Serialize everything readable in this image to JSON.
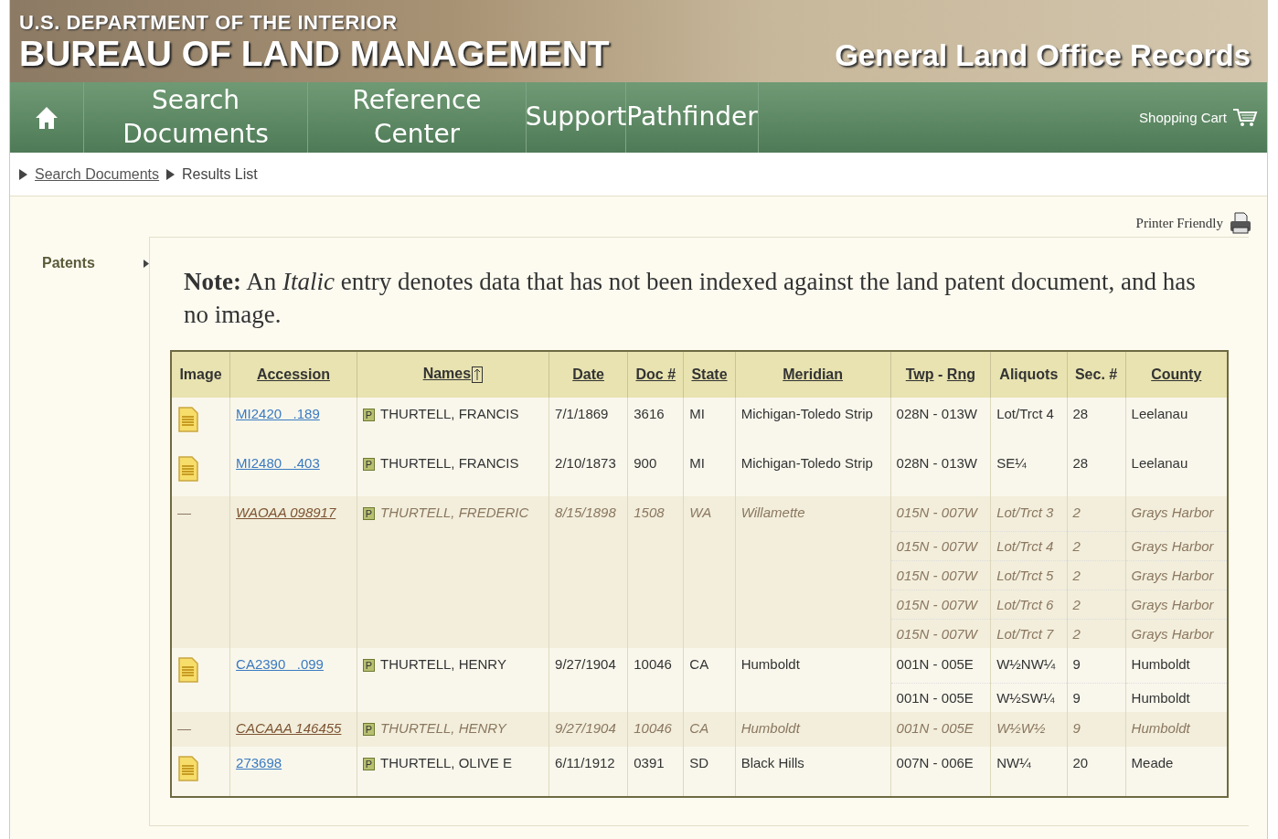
{
  "header": {
    "department": "U.S. DEPARTMENT OF THE INTERIOR",
    "bureau": "BUREAU OF LAND MANAGEMENT",
    "site_title": "General Land Office Records"
  },
  "nav": {
    "items": [
      {
        "label": "Search Documents"
      },
      {
        "label": "Reference Center"
      },
      {
        "label": "Support"
      },
      {
        "label": "Pathfinder"
      }
    ],
    "cart": "Shopping Cart"
  },
  "breadcrumbs": [
    {
      "label": "Search Documents",
      "link": true
    },
    {
      "label": "Results List",
      "link": false
    }
  ],
  "printer_friendly": "Printer Friendly",
  "sidebar": {
    "items": [
      {
        "label": "Patents"
      }
    ]
  },
  "note": "**Note:** An *Italic* entry denotes data that has not been indexed against the land patent document, and has no image.",
  "table": {
    "columns": [
      {
        "label": "Image",
        "sortable": false
      },
      {
        "label": "Accession",
        "sortable": true
      },
      {
        "label": "Names",
        "sortable": true
      },
      {
        "label": "Date",
        "sortable": true
      },
      {
        "label": "Doc #",
        "sortable": true
      },
      {
        "label": "State",
        "sortable": true
      },
      {
        "label": "Meridian",
        "sortable": true
      },
      {
        "label": "Twp",
        "sortable": true,
        "joiner": "-",
        "label_2": "Rng"
      },
      {
        "label": "Aliquots",
        "sortable": false
      },
      {
        "label": "Sec. #",
        "sortable": false
      },
      {
        "label": "County",
        "sortable": true
      }
    ],
    "rows": [
      {
        "kind": "scanned",
        "accession": "MI2420   .189",
        "badge": "P",
        "name": "THURTELL, FRANCIS",
        "date": "7/1/1869",
        "doc": "3616",
        "state": "MI",
        "meridian": "Michigan-Toledo Strip",
        "parcels": [
          {
            "twp_rng": "028N - 013W",
            "aliquots": "Lot/Trct 4",
            "sec": "28",
            "county": "Leelanau"
          }
        ]
      },
      {
        "kind": "scanned",
        "accession": "MI2480   .403",
        "badge": "P",
        "name": "THURTELL, FRANCIS",
        "date": "2/10/1873",
        "doc": "900",
        "state": "MI",
        "meridian": "Michigan-Toledo Strip",
        "parcels": [
          {
            "twp_rng": "028N - 013W",
            "aliquots": "SE¼",
            "sec": "28",
            "county": "Leelanau"
          }
        ]
      },
      {
        "kind": "unindexed",
        "image_text": "—",
        "accession": "WAOAA 098917",
        "badge": "P",
        "name": "THURTELL, FREDERIC",
        "date": "8/15/1898",
        "doc": "1508",
        "state": "WA",
        "meridian": "Willamette",
        "parcels": [
          {
            "twp_rng": "015N - 007W",
            "aliquots": "Lot/Trct 3",
            "sec": "2",
            "county": "Grays Harbor"
          },
          {
            "twp_rng": "015N - 007W",
            "aliquots": "Lot/Trct 4",
            "sec": "2",
            "county": "Grays Harbor"
          },
          {
            "twp_rng": "015N - 007W",
            "aliquots": "Lot/Trct 5",
            "sec": "2",
            "county": "Grays Harbor"
          },
          {
            "twp_rng": "015N - 007W",
            "aliquots": "Lot/Trct 6",
            "sec": "2",
            "county": "Grays Harbor"
          },
          {
            "twp_rng": "015N - 007W",
            "aliquots": "Lot/Trct 7",
            "sec": "2",
            "county": "Grays Harbor"
          }
        ]
      },
      {
        "kind": "scanned",
        "accession": "CA2390   .099",
        "badge": "P",
        "name": "THURTELL, HENRY",
        "date": "9/27/1904",
        "doc": "10046",
        "state": "CA",
        "meridian": "Humboldt",
        "parcels": [
          {
            "twp_rng": "001N - 005E",
            "aliquots": "W½NW¼",
            "sec": "9",
            "county": "Humboldt"
          },
          {
            "twp_rng": "001N - 005E",
            "aliquots": "W½SW¼",
            "sec": "9",
            "county": "Humboldt"
          }
        ]
      },
      {
        "kind": "unindexed",
        "image_text": "—",
        "accession": "CACAAA 146455",
        "badge": "P",
        "name": "THURTELL, HENRY",
        "date": "9/27/1904",
        "doc": "10046",
        "state": "CA",
        "meridian": "Humboldt",
        "parcels": [
          {
            "twp_rng": "001N - 005E",
            "aliquots": "W½W½",
            "sec": "9",
            "county": "Humboldt"
          }
        ]
      },
      {
        "kind": "scanned",
        "accession": "273698",
        "badge": "P",
        "name": "THURTELL, OLIVE E",
        "date": "6/11/1912",
        "doc": "0391",
        "state": "SD",
        "meridian": "Black Hills",
        "parcels": [
          {
            "twp_rng": "007N - 006E",
            "aliquots": "NW¼",
            "sec": "20",
            "county": "Meade"
          }
        ]
      }
    ]
  }
}
